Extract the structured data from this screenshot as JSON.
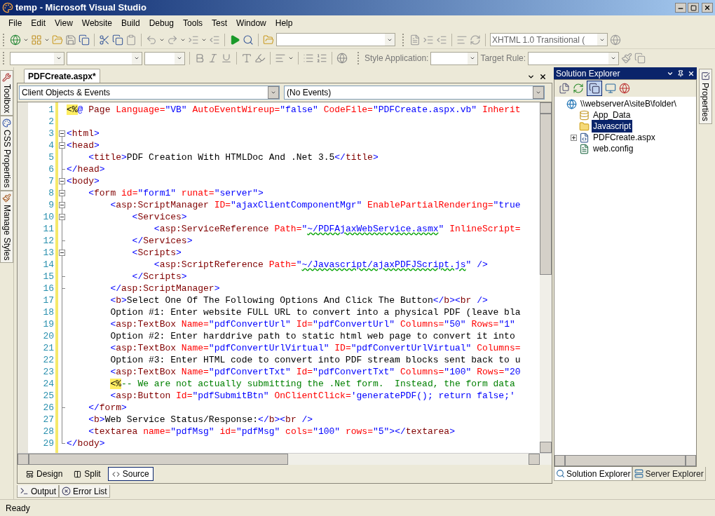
{
  "window": {
    "title": "temp - Microsoft Visual Studio"
  },
  "menu": [
    "File",
    "Edit",
    "View",
    "Website",
    "Build",
    "Debug",
    "Tools",
    "Test",
    "Window",
    "Help"
  ],
  "toolbar": {
    "doctype": "XHTML 1.0 Transitional (",
    "style_application_label": "Style Application:",
    "target_rule_label": "Target Rule:"
  },
  "side_tabs": [
    "Toolbox",
    "CSS Properties",
    "Manage Styles"
  ],
  "editor": {
    "tabs": [
      {
        "label": "PDFCreate.aspx*",
        "selected": true
      }
    ],
    "object_dropdown": "Client Objects & Events",
    "event_dropdown": "(No Events)",
    "lines": [
      {
        "number": "1",
        "kind": "plain",
        "tokens": [
          {
            "kind": "marker",
            "text": "<%"
          },
          {
            "kind": "bracket",
            "text": "@"
          },
          {
            "kind": "tag",
            "text": " Page"
          },
          {
            "kind": "attr",
            "text": " Language="
          },
          {
            "kind": "value",
            "text": "\"VB\""
          },
          {
            "kind": "attr",
            "text": " AutoEventWireup="
          },
          {
            "kind": "value",
            "text": "\"false\""
          },
          {
            "kind": "attr",
            "text": " CodeFile="
          },
          {
            "kind": "value",
            "text": "\"PDFCreate.aspx.vb\""
          },
          {
            "kind": "attr",
            "text": " Inherit"
          }
        ]
      },
      {
        "number": "2",
        "kind": "plain"
      },
      {
        "number": "3",
        "kind": "open",
        "tokens": [
          {
            "kind": "bracket",
            "text": "<"
          },
          {
            "kind": "tag",
            "text": "html"
          },
          {
            "kind": "bracket",
            "text": ">"
          }
        ]
      },
      {
        "number": "4",
        "kind": "open",
        "tokens": [
          {
            "kind": "bracket",
            "text": "<"
          },
          {
            "kind": "tag",
            "text": "head"
          },
          {
            "kind": "bracket",
            "text": ">"
          }
        ]
      },
      {
        "number": "5",
        "kind": "inner",
        "tokens": [
          {
            "kind": "bracket",
            "text": "    <"
          },
          {
            "kind": "tag",
            "text": "title"
          },
          {
            "kind": "bracket",
            "text": ">"
          },
          {
            "kind": "text",
            "text": "PDF Creation With HTMLDoc And .Net 3.5"
          },
          {
            "kind": "bracket",
            "text": "</"
          },
          {
            "kind": "tag",
            "text": "title"
          },
          {
            "kind": "bracket",
            "text": ">"
          }
        ]
      },
      {
        "number": "6",
        "kind": "close",
        "tokens": [
          {
            "kind": "bracket",
            "text": "</"
          },
          {
            "kind": "tag",
            "text": "head"
          },
          {
            "kind": "bracket",
            "text": ">"
          }
        ]
      },
      {
        "number": "7",
        "kind": "open",
        "tokens": [
          {
            "kind": "bracket",
            "text": "<"
          },
          {
            "kind": "tag",
            "text": "body"
          },
          {
            "kind": "bracket",
            "text": ">"
          }
        ]
      },
      {
        "number": "8",
        "kind": "open",
        "tokens": [
          {
            "kind": "bracket",
            "text": "    <"
          },
          {
            "kind": "tag",
            "text": "form"
          },
          {
            "kind": "attr",
            "text": " id="
          },
          {
            "kind": "value",
            "text": "\"form1\""
          },
          {
            "kind": "attr",
            "text": " runat="
          },
          {
            "kind": "value",
            "text": "\"server\""
          },
          {
            "kind": "bracket",
            "text": ">"
          }
        ]
      },
      {
        "number": "9",
        "kind": "open",
        "tokens": [
          {
            "kind": "bracket",
            "text": "        <"
          },
          {
            "kind": "tag",
            "text": "asp:ScriptManager"
          },
          {
            "kind": "attr",
            "text": " ID="
          },
          {
            "kind": "value",
            "text": "\"ajaxClientComponentMgr\""
          },
          {
            "kind": "attr",
            "text": " EnablePartialRendering="
          },
          {
            "kind": "value",
            "text": "\"true"
          }
        ]
      },
      {
        "number": "10",
        "kind": "open",
        "tokens": [
          {
            "kind": "bracket",
            "text": "            <"
          },
          {
            "kind": "tag",
            "text": "Services"
          },
          {
            "kind": "bracket",
            "text": ">"
          }
        ]
      },
      {
        "number": "11",
        "kind": "inner",
        "tokens": [
          {
            "kind": "bracket",
            "text": "                <"
          },
          {
            "kind": "tag",
            "text": "asp:ServiceReference"
          },
          {
            "kind": "attr",
            "text": " Path="
          },
          {
            "kind": "value",
            "text": "\""
          },
          {
            "kind": "flagged-value",
            "text": "~/PDFAjaxWebService.asmx"
          },
          {
            "kind": "value",
            "text": "\""
          },
          {
            "kind": "attr",
            "text": " InlineScript="
          }
        ]
      },
      {
        "number": "12",
        "kind": "close",
        "tokens": [
          {
            "kind": "bracket",
            "text": "            </"
          },
          {
            "kind": "tag",
            "text": "Services"
          },
          {
            "kind": "bracket",
            "text": ">"
          }
        ]
      },
      {
        "number": "13",
        "kind": "open",
        "tokens": [
          {
            "kind": "bracket",
            "text": "            <"
          },
          {
            "kind": "tag",
            "text": "Scripts"
          },
          {
            "kind": "bracket",
            "text": ">"
          }
        ]
      },
      {
        "number": "14",
        "kind": "inner",
        "tokens": [
          {
            "kind": "bracket",
            "text": "                <"
          },
          {
            "kind": "tag",
            "text": "asp:ScriptReference"
          },
          {
            "kind": "attr",
            "text": " Path="
          },
          {
            "kind": "value",
            "text": "\""
          },
          {
            "kind": "flagged-value",
            "text": "~/Javascript/ajaxPDFJScript.js"
          },
          {
            "kind": "value",
            "text": "\""
          },
          {
            "kind": "bracket",
            "text": " />"
          }
        ]
      },
      {
        "number": "15",
        "kind": "close",
        "tokens": [
          {
            "kind": "bracket",
            "text": "            </"
          },
          {
            "kind": "tag",
            "text": "Scripts"
          },
          {
            "kind": "bracket",
            "text": ">"
          }
        ]
      },
      {
        "number": "16",
        "kind": "close",
        "tokens": [
          {
            "kind": "bracket",
            "text": "        </"
          },
          {
            "kind": "tag",
            "text": "asp:ScriptManager"
          },
          {
            "kind": "bracket",
            "text": ">"
          }
        ]
      },
      {
        "number": "17",
        "kind": "inner",
        "tokens": [
          {
            "kind": "bracket",
            "text": "        <"
          },
          {
            "kind": "tag",
            "text": "b"
          },
          {
            "kind": "bracket",
            "text": ">"
          },
          {
            "kind": "text",
            "text": "Select One Of The Following Options And Click The Button"
          },
          {
            "kind": "bracket",
            "text": "</"
          },
          {
            "kind": "tag",
            "text": "b"
          },
          {
            "kind": "bracket",
            "text": "><"
          },
          {
            "kind": "tag",
            "text": "br"
          },
          {
            "kind": "bracket",
            "text": " />"
          }
        ]
      },
      {
        "number": "18",
        "kind": "inner",
        "tokens": [
          {
            "kind": "text",
            "text": "        Option #1: Enter website FULL URL to convert into a physical PDF (leave bla"
          }
        ]
      },
      {
        "number": "19",
        "kind": "inner",
        "tokens": [
          {
            "kind": "bracket",
            "text": "        <"
          },
          {
            "kind": "tag",
            "text": "asp:TextBox"
          },
          {
            "kind": "attr",
            "text": " Name="
          },
          {
            "kind": "value",
            "text": "\"pdfConvertUrl\""
          },
          {
            "kind": "attr",
            "text": " Id="
          },
          {
            "kind": "value",
            "text": "\"pdfConvertUrl\""
          },
          {
            "kind": "attr",
            "text": " Columns="
          },
          {
            "kind": "value",
            "text": "\"50\""
          },
          {
            "kind": "attr",
            "text": " Rows="
          },
          {
            "kind": "value",
            "text": "\"1\""
          }
        ]
      },
      {
        "number": "20",
        "kind": "inner",
        "tokens": [
          {
            "kind": "text",
            "text": "        Option #2: Enter harddrive path to static html web page to convert it into"
          }
        ]
      },
      {
        "number": "21",
        "kind": "inner",
        "tokens": [
          {
            "kind": "bracket",
            "text": "        <"
          },
          {
            "kind": "tag",
            "text": "asp:TextBox"
          },
          {
            "kind": "attr",
            "text": " Name="
          },
          {
            "kind": "value",
            "text": "\"pdfConvertUrlVirtual\""
          },
          {
            "kind": "attr",
            "text": " ID="
          },
          {
            "kind": "value",
            "text": "\"pdfConvertUrlVirtual\""
          },
          {
            "kind": "attr",
            "text": " Columns="
          }
        ]
      },
      {
        "number": "22",
        "kind": "inner",
        "tokens": [
          {
            "kind": "text",
            "text": "        Option #3: Enter HTML code to convert into PDF stream blocks sent back to u"
          }
        ]
      },
      {
        "number": "23",
        "kind": "inner",
        "tokens": [
          {
            "kind": "bracket",
            "text": "        <"
          },
          {
            "kind": "tag",
            "text": "asp:TextBox"
          },
          {
            "kind": "attr",
            "text": " Name="
          },
          {
            "kind": "value",
            "text": "\"pdfConvertTxt\""
          },
          {
            "kind": "attr",
            "text": " Id="
          },
          {
            "kind": "value",
            "text": "\"pdfConvertTxt\""
          },
          {
            "kind": "attr",
            "text": " Columns="
          },
          {
            "kind": "value",
            "text": "\"100\""
          },
          {
            "kind": "attr",
            "text": " Rows="
          },
          {
            "kind": "value",
            "text": "\"20"
          }
        ]
      },
      {
        "number": "24",
        "kind": "inner",
        "tokens": [
          {
            "kind": "marker",
            "text": "        <%"
          },
          {
            "kind": "comment",
            "text": "-- We are not actually submitting the .Net form.  Instead, the form data"
          }
        ]
      },
      {
        "number": "25",
        "kind": "inner",
        "tokens": [
          {
            "kind": "bracket",
            "text": "        <"
          },
          {
            "kind": "tag",
            "text": "asp:Button"
          },
          {
            "kind": "attr",
            "text": " Id="
          },
          {
            "kind": "value",
            "text": "\"pdfSubmitBtn\""
          },
          {
            "kind": "attr",
            "text": " OnClientClick="
          },
          {
            "kind": "value",
            "text": "'generatePDF(); return false;'"
          }
        ]
      },
      {
        "number": "26",
        "kind": "close",
        "tokens": [
          {
            "kind": "bracket",
            "text": "    </"
          },
          {
            "kind": "tag",
            "text": "form"
          },
          {
            "kind": "bracket",
            "text": ">"
          }
        ]
      },
      {
        "number": "27",
        "kind": "inner",
        "tokens": [
          {
            "kind": "bracket",
            "text": "    <"
          },
          {
            "kind": "tag",
            "text": "b"
          },
          {
            "kind": "bracket",
            "text": ">"
          },
          {
            "kind": "text",
            "text": "Web Service Status/Response:"
          },
          {
            "kind": "bracket",
            "text": "</"
          },
          {
            "kind": "tag",
            "text": "b"
          },
          {
            "kind": "bracket",
            "text": "><"
          },
          {
            "kind": "tag",
            "text": "br"
          },
          {
            "kind": "bracket",
            "text": " />"
          }
        ]
      },
      {
        "number": "28",
        "kind": "inner",
        "tokens": [
          {
            "kind": "bracket",
            "text": "    <"
          },
          {
            "kind": "tag",
            "text": "textarea"
          },
          {
            "kind": "attr",
            "text": " name="
          },
          {
            "kind": "value",
            "text": "\"pdfMsg\""
          },
          {
            "kind": "attr",
            "text": " id="
          },
          {
            "kind": "value",
            "text": "\"pdfMsg\""
          },
          {
            "kind": "attr",
            "text": " cols="
          },
          {
            "kind": "value",
            "text": "\"100\""
          },
          {
            "kind": "attr",
            "text": " rows="
          },
          {
            "kind": "value",
            "text": "\"5\""
          },
          {
            "kind": "bracket",
            "text": "></"
          },
          {
            "kind": "tag",
            "text": "textarea"
          },
          {
            "kind": "bracket",
            "text": ">"
          }
        ]
      },
      {
        "number": "29",
        "kind": "close",
        "tokens": [
          {
            "kind": "bracket",
            "text": "</"
          },
          {
            "kind": "tag",
            "text": "body"
          },
          {
            "kind": "bracket",
            "text": ">"
          }
        ]
      }
    ],
    "view_tabs": [
      {
        "label": "Design",
        "kind": "design",
        "selected": false
      },
      {
        "label": "Split",
        "kind": "split",
        "selected": false
      },
      {
        "label": "Source",
        "kind": "source",
        "selected": true
      }
    ]
  },
  "solution_explorer": {
    "title": "Solution Explorer",
    "tree": [
      {
        "label": "\\\\webserverA\\siteB\\folder\\",
        "kind": "site",
        "selected": false,
        "expanded": true,
        "children": [
          {
            "label": "App_Data",
            "kind": "data-folder",
            "selected": false
          },
          {
            "label": "Javascript",
            "kind": "folder",
            "selected": true
          },
          {
            "label": "PDFCreate.aspx",
            "kind": "page",
            "selected": false,
            "expanded": false
          },
          {
            "label": "web.config",
            "kind": "config",
            "selected": false
          }
        ]
      }
    ],
    "tabs": [
      {
        "label": "Solution Explorer",
        "kind": "solution",
        "selected": true
      },
      {
        "label": "Server Explorer",
        "kind": "server",
        "selected": false
      }
    ]
  },
  "properties_tab": "Properties",
  "bottom_tabs": [
    {
      "label": "Output",
      "kind": "output"
    },
    {
      "label": "Error List",
      "kind": "errors"
    }
  ],
  "status_bar": "Ready"
}
